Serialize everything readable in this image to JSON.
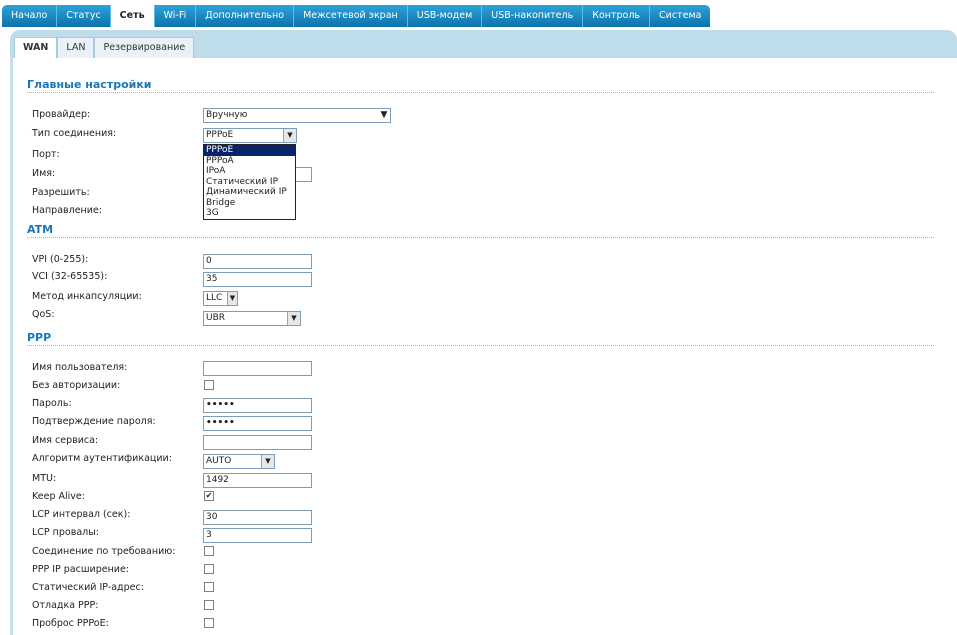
{
  "top_tabs": [
    "Начало",
    "Статус",
    "Сеть",
    "Wi-Fi",
    "Дополнительно",
    "Межсетевой экран",
    "USB-модем",
    "USB-накопитель",
    "Контроль",
    "Система"
  ],
  "sub_tabs": [
    "WAN",
    "LAN",
    "Резервирование"
  ],
  "sections": {
    "main": "Главные настройки",
    "atm": "ATM",
    "ppp": "PPP"
  },
  "main": {
    "provider_label": "Провайдер:",
    "provider_value": "Вручную",
    "conn_type_label": "Тип соединения:",
    "conn_type_value": "PPPoE",
    "port_label": "Порт:",
    "name_label": "Имя:",
    "allow_label": "Разрешить:",
    "direction_label": "Направление:",
    "conn_type_options": [
      "PPPoE",
      "PPPoA",
      "IPoA",
      "Статический IP",
      "Динамический IP",
      "Bridge",
      "3G"
    ]
  },
  "atm": {
    "vpi_label": "VPI (0-255):",
    "vpi_value": "0",
    "vci_label": "VCI (32-65535):",
    "vci_value": "35",
    "encap_label": "Метод инкапсуляции:",
    "encap_value": "LLC",
    "qos_label": "QoS:",
    "qos_value": "UBR"
  },
  "ppp": {
    "username_label": "Имя пользователя:",
    "username_value": "",
    "noauth_label": "Без авторизации:",
    "noauth_checked": false,
    "password_label": "Пароль:",
    "password_value": "•••••",
    "confirm_label": "Подтверждение пароля:",
    "confirm_value": "•••••",
    "service_label": "Имя сервиса:",
    "service_value": "",
    "auth_algo_label": "Алгоритм аутентификации:",
    "auth_algo_value": "AUTO",
    "mtu_label": "MTU:",
    "mtu_value": "1492",
    "keepalive_label": "Keep Alive:",
    "keepalive_checked": true,
    "lcp_interval_label": "LCP интервал (сек):",
    "lcp_interval_value": "30",
    "lcp_fails_label": "LCP провалы:",
    "lcp_fails_value": "3",
    "on_demand_label": "Соединение по требованию:",
    "ppp_ip_ext_label": "PPP IP расширение:",
    "static_ip_label": "Статический IP-адрес:",
    "debug_label": "Отладка PPP:",
    "passthrough_label": "Проброс PPPoE:"
  },
  "colors": {
    "tab_blue": "#1384c0",
    "section_blue": "#1a78b8",
    "band": "#bfdcea",
    "highlight": "#0a246a"
  }
}
